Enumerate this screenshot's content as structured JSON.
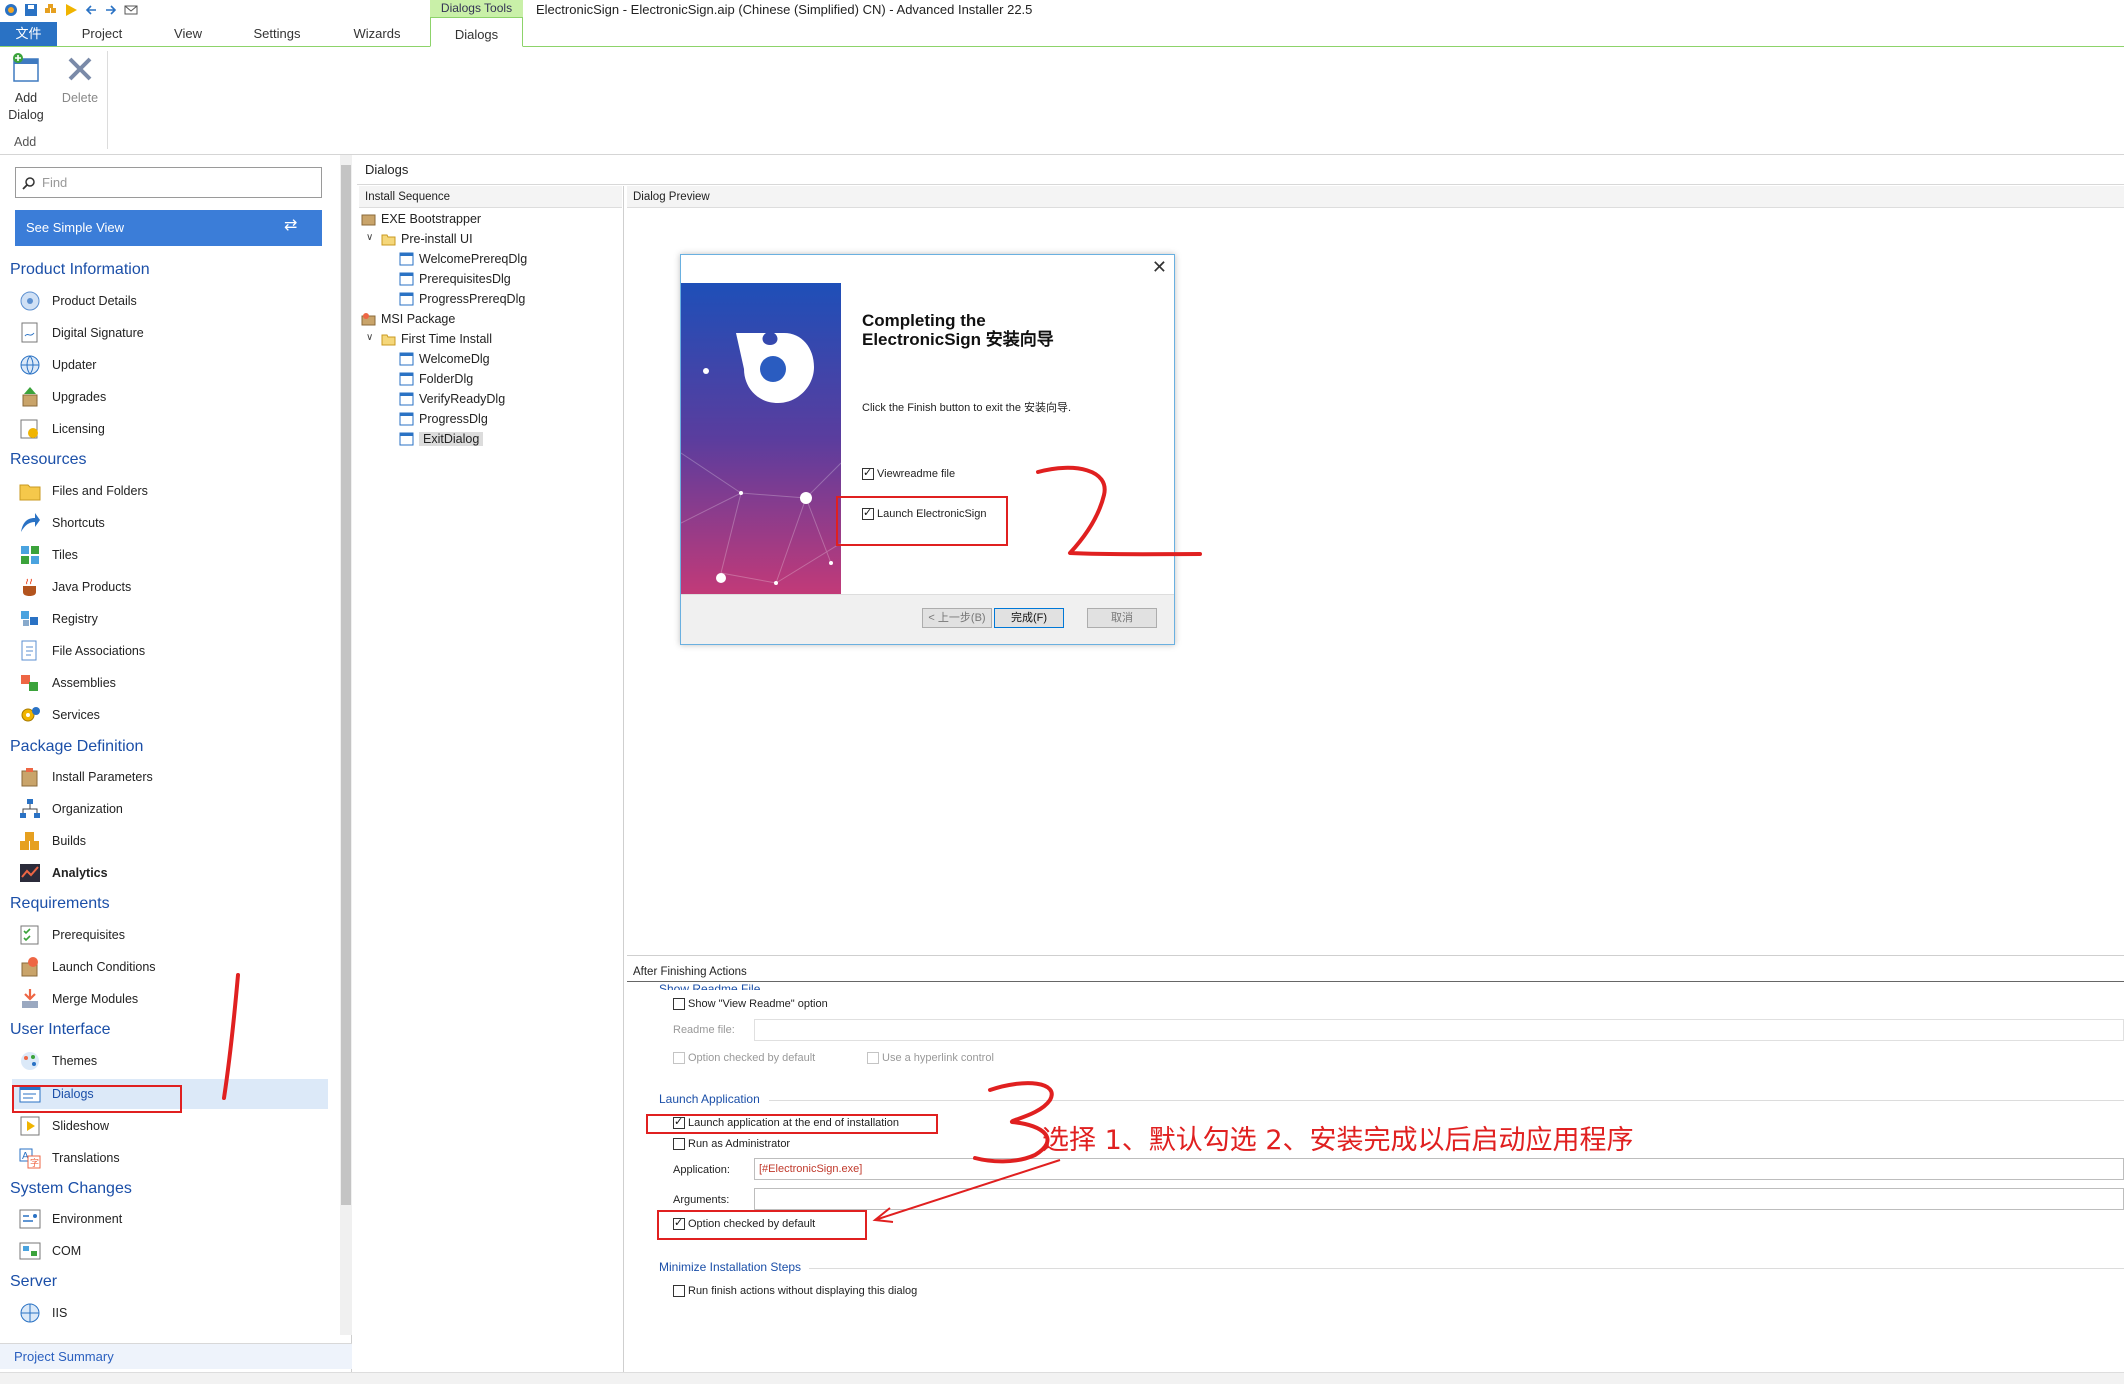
{
  "app": {
    "title": "ElectronicSign - ElectronicSign.aip (Chinese (Simplified) CN) - Advanced Installer 22.5",
    "context_tab": "Dialogs Tools"
  },
  "tabs": [
    {
      "label": "文件",
      "active": false
    },
    {
      "label": "Project",
      "active": false
    },
    {
      "label": "View",
      "active": false
    },
    {
      "label": "Settings",
      "active": false
    },
    {
      "label": "Wizards",
      "active": false
    },
    {
      "label": "Dialogs",
      "active": true
    }
  ],
  "ribbon": {
    "add_dialog": "Add\nDialog",
    "delete": "Delete",
    "group": "Add"
  },
  "sidebar": {
    "find_placeholder": "Find",
    "simple_view": "See Simple View",
    "project_summary": "Project Summary",
    "sections": {
      "product_information": "Product Information",
      "resources": "Resources",
      "package_definition": "Package Definition",
      "requirements": "Requirements",
      "user_interface": "User Interface",
      "system_changes": "System Changes",
      "server": "Server"
    },
    "items": {
      "product_details": "Product Details",
      "digital_signature": "Digital Signature",
      "updater": "Updater",
      "upgrades": "Upgrades",
      "licensing": "Licensing",
      "files_folders": "Files and Folders",
      "shortcuts": "Shortcuts",
      "tiles": "Tiles",
      "java_products": "Java Products",
      "registry": "Registry",
      "file_associations": "File Associations",
      "assemblies": "Assemblies",
      "services": "Services",
      "install_parameters": "Install Parameters",
      "organization": "Organization",
      "builds": "Builds",
      "analytics": "Analytics",
      "prerequisites": "Prerequisites",
      "launch_conditions": "Launch Conditions",
      "merge_modules": "Merge Modules",
      "themes": "Themes",
      "dialogs": "Dialogs",
      "slideshow": "Slideshow",
      "translations": "Translations",
      "environment": "Environment",
      "com": "COM",
      "iis": "IIS"
    }
  },
  "main": {
    "header": "Dialogs",
    "install_sequence_header": "Install Sequence",
    "tree": {
      "exe_bootstrapper": "EXE Bootstrapper",
      "pre_install_ui": "Pre-install UI",
      "welcome_prereq": "WelcomePrereqDlg",
      "prerequisites_dlg": "PrerequisitesDlg",
      "progress_prereq": "ProgressPrereqDlg",
      "msi_package": "MSI Package",
      "first_time_install": "First Time Install",
      "welcome_dlg": "WelcomeDlg",
      "folder_dlg": "FolderDlg",
      "verify_ready": "VerifyReadyDlg",
      "progress_dlg": "ProgressDlg",
      "exit_dialog": "ExitDialog"
    },
    "preview_header": "Dialog Preview",
    "wizard": {
      "close": "✕",
      "title_line1": "Completing the",
      "title_line2": "ElectronicSign 安装向导",
      "description": "Click the Finish button to exit the 安装向导.",
      "view_readme": "Viewreadme file",
      "launch_label": "Launch ElectronicSign",
      "launch_checked": true,
      "btn_back": "< 上一步(B)",
      "btn_finish": "完成(F)",
      "btn_cancel": "取消"
    },
    "props": {
      "header": "After Finishing  Actions",
      "show_readme_group": "Show Readme File",
      "show_view_readme": "Show \"View Readme\" option",
      "readme_file_label": "Readme file:",
      "option_checked_default_1": "Option checked by default",
      "use_hyperlink": "Use a hyperlink control",
      "launch_group": "Launch Application",
      "launch_at_end": "Launch application at the end of installation",
      "launch_at_end_checked": true,
      "run_as_admin": "Run as Administrator",
      "application_label": "Application:",
      "application_value": "[#ElectronicSign.exe]",
      "arguments_label": "Arguments:",
      "option_checked_default_2": "Option checked by default",
      "option_checked_default_2_checked": true,
      "minimize_group": "Minimize Installation Steps",
      "run_finish_actions": "Run finish actions without displaying this dialog"
    }
  },
  "annotation": {
    "text": "选择 1、默认勾选 2、安装完成以后启动应用程序",
    "color": "#e02020"
  }
}
